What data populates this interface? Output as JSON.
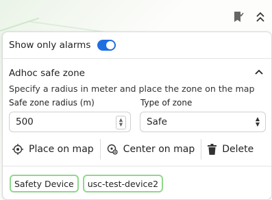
{
  "filters": {
    "show_only_alarms_label": "Show only alarms",
    "show_only_alarms": true
  },
  "safe_zone": {
    "title": "Adhoc safe zone",
    "description": "Specify a radius in meter and place the zone on the map",
    "radius_label": "Safe zone radius (m)",
    "radius_value": "500",
    "type_label": "Type of zone",
    "type_value": "Safe",
    "place_label": "Place on map",
    "center_label": "Center on map",
    "delete_label": "Delete"
  },
  "devices": [
    "Safety Device",
    "usc-test-device2"
  ],
  "colors": {
    "accent": "#1e6fe0",
    "chip_border": "#8fd88a"
  }
}
